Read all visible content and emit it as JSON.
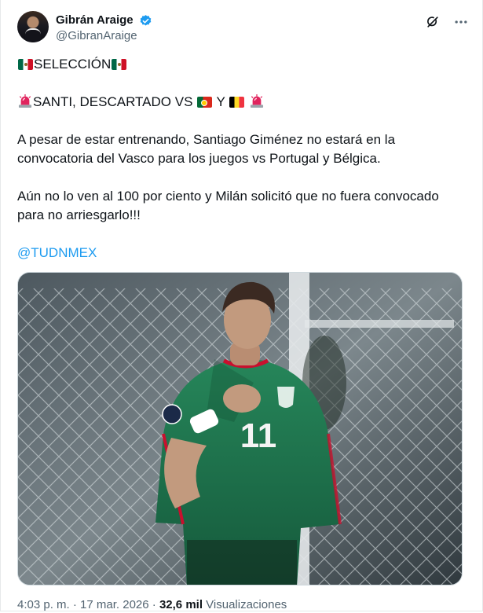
{
  "author": {
    "display_name": "Gibrán Araige",
    "handle": "@GibranAraige",
    "verified": true
  },
  "tweet": {
    "line1_text": "SELECCIÓN",
    "line2_text": "SANTI, DESCARTADO VS ",
    "line2_conj": " Y ",
    "paragraph1": "A pesar de estar entrenando, Santiago Giménez no estará en la convocatoria del Vasco para los juegos vs Portugal y Bélgica.",
    "paragraph2": "Aún no lo ven al 100 por ciento y Milán solicitó que no fuera convocado para no arriesgarlo!!!",
    "mention": "@TUDNMEX",
    "emoji": {
      "flag_mexico": "flag-mexico-icon",
      "flag_portugal": "flag-portugal-icon",
      "flag_belgium": "flag-belgium-icon",
      "siren": "police-siren-icon"
    }
  },
  "media": {
    "jersey_number": "11",
    "colors": {
      "jersey": "#1f7a4f",
      "jersey_trim": "#c8102e",
      "background_net": "#e9eef0"
    }
  },
  "meta": {
    "time": "4:03 p. m.",
    "separator": "·",
    "date": "17 mar. 2026",
    "views_count": "32,6 mil",
    "views_label": "Visualizaciones"
  },
  "colors": {
    "accent": "#1d9bf0",
    "text": "#0f1419",
    "secondary": "#536471"
  }
}
